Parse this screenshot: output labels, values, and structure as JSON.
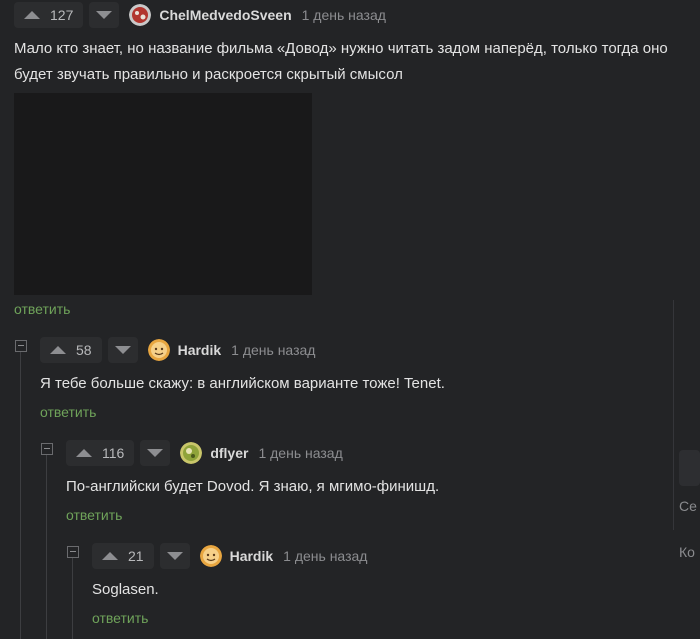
{
  "comments": [
    {
      "rating": "127",
      "username": "ChelMedvedoSveen",
      "time": "1 день назад",
      "text_line1": "Мало кто знает, но название фильма «Довод» нужно читать задом наперёд, только тогда оно",
      "text_line2": "будет звучать правильно и раскроется скрытый смысол",
      "reply": "ответить",
      "avatar_icon": "avatar-red-icon"
    },
    {
      "rating": "58",
      "username": "Hardik",
      "time": "1 день назад",
      "text": "Я тебе больше скажу: в английском варианте тоже! Tenet.",
      "reply": "ответить",
      "avatar_icon": "avatar-smiley-icon"
    },
    {
      "rating": "116",
      "username": "dflyer",
      "time": "1 день назад",
      "text": "По-английски будет Dovod. Я знаю, я мгимо-финишд.",
      "reply": "ответить",
      "avatar_icon": "avatar-green-icon"
    },
    {
      "rating": "21",
      "username": "Hardik",
      "time": "1 день назад",
      "text": "Soglasen.",
      "reply": "ответить",
      "avatar_icon": "avatar-smiley-icon"
    }
  ],
  "sidebar": {
    "text1": "Се",
    "text2": "Ко"
  },
  "colors": {
    "background": "#232426",
    "reply_link": "#6fa35a",
    "meta_box": "#2c2d2f"
  }
}
